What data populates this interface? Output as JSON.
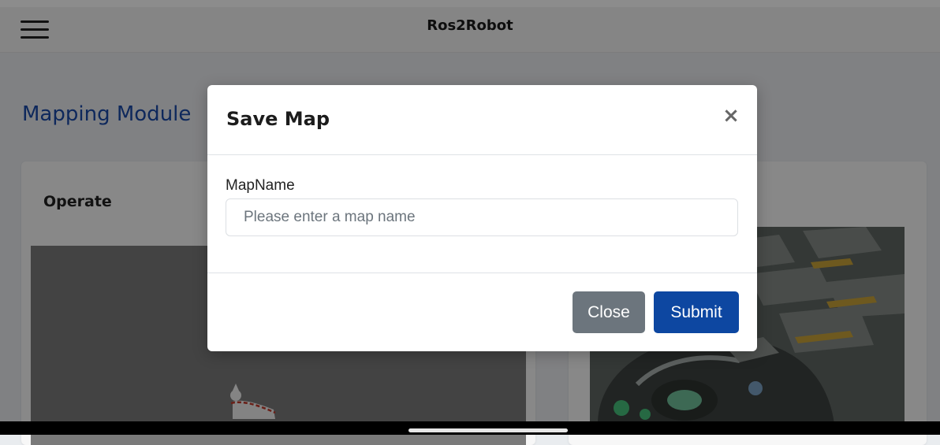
{
  "header": {
    "title": "Ros2Robot",
    "menu_icon": "hamburger-menu-icon"
  },
  "page": {
    "heading": "Mapping Module",
    "left_card": {
      "title": "Operate"
    }
  },
  "modal": {
    "title": "Save Map",
    "close_glyph": "×",
    "field_label": "MapName",
    "field_value": "",
    "field_placeholder": "Please enter a map name",
    "close_label": "Close",
    "submit_label": "Submit"
  },
  "colors": {
    "heading": "#1a4aa8",
    "submit": "#0d47a1",
    "close": "#6c757d",
    "overlay": "rgba(0,0,0,0.45)"
  }
}
